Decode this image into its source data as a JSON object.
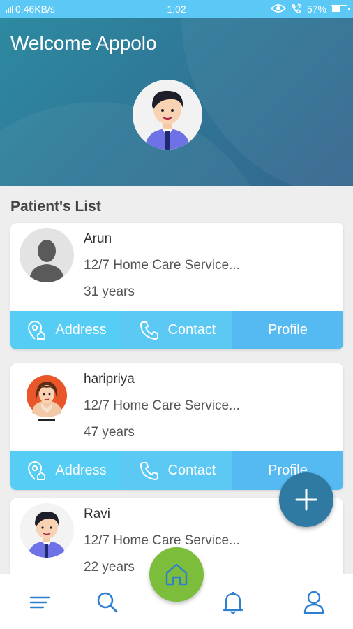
{
  "status_bar": {
    "network_speed": "0.46KB/s",
    "time": "1:02",
    "battery": "57%",
    "battery_level": 0.57,
    "icons": [
      "signal-icon",
      "eye-icon",
      "wifi-call-icon",
      "battery-icon"
    ]
  },
  "header": {
    "title": "Welcome Appolo",
    "avatar": "doctor-avatar"
  },
  "patients_section": {
    "title": "Patient's List"
  },
  "patients": [
    {
      "name": "Arun",
      "service": "12/7 Home Care Service...",
      "age": "31 years",
      "avatar": "placeholder-person-avatar",
      "actions": {
        "address": "Address",
        "contact": "Contact",
        "profile": "Profile"
      }
    },
    {
      "name": "haripriya",
      "service": "12/7 Home Care Service...",
      "age": "47 years",
      "avatar": "woman-avatar",
      "actions": {
        "address": "Address",
        "contact": "Contact",
        "profile": "Profile"
      }
    },
    {
      "name": "Ravi",
      "service": "12/7 Home Care Service...",
      "age": "22 years",
      "avatar": "man-avatar"
    }
  ],
  "fab": {
    "icon": "plus-icon"
  },
  "bottom_nav": {
    "items": [
      "menu-icon",
      "search-icon",
      "home-icon",
      "bell-icon",
      "user-icon"
    ]
  },
  "colors": {
    "status_bar": "#5bc8f5",
    "header": "#2f7696",
    "action_bar": "#55cdf5",
    "fab": "#2f7aa2",
    "home_button": "#7dbd3c",
    "nav_icon": "#2f7fd0"
  }
}
